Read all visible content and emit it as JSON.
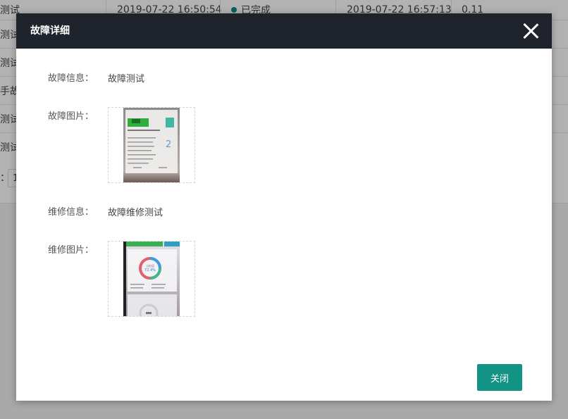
{
  "background_table": {
    "first_row": {
      "name": "测试",
      "start_time": "2019-07-22 16:50:54",
      "status": "已完成",
      "end_time": "2019-07-22 16:57:13",
      "value": "0.11"
    },
    "partial_rows": [
      "测试",
      "测试",
      "手故",
      "测试",
      "测试"
    ],
    "pager_label": "：",
    "pager_value": "1"
  },
  "modal": {
    "title": "故障详细",
    "fault_info_label": "故障信息：",
    "fault_info_value": "故障测试",
    "fault_image_label": "故障图片：",
    "repair_info_label": "维修信息：",
    "repair_info_value": "故障维修测试",
    "repair_image_label": "维修图片：",
    "close_button": "关闭",
    "fault_photo": {
      "screen_number": "2",
      "header_text": "设备报修故障处理工单"
    },
    "repair_photo": {
      "gauge_label": "当前值",
      "gauge_value": "72.4%"
    }
  },
  "colors": {
    "header_bg": "#1f232b",
    "accent": "#129484",
    "status_dot": "#0f8a7d"
  }
}
